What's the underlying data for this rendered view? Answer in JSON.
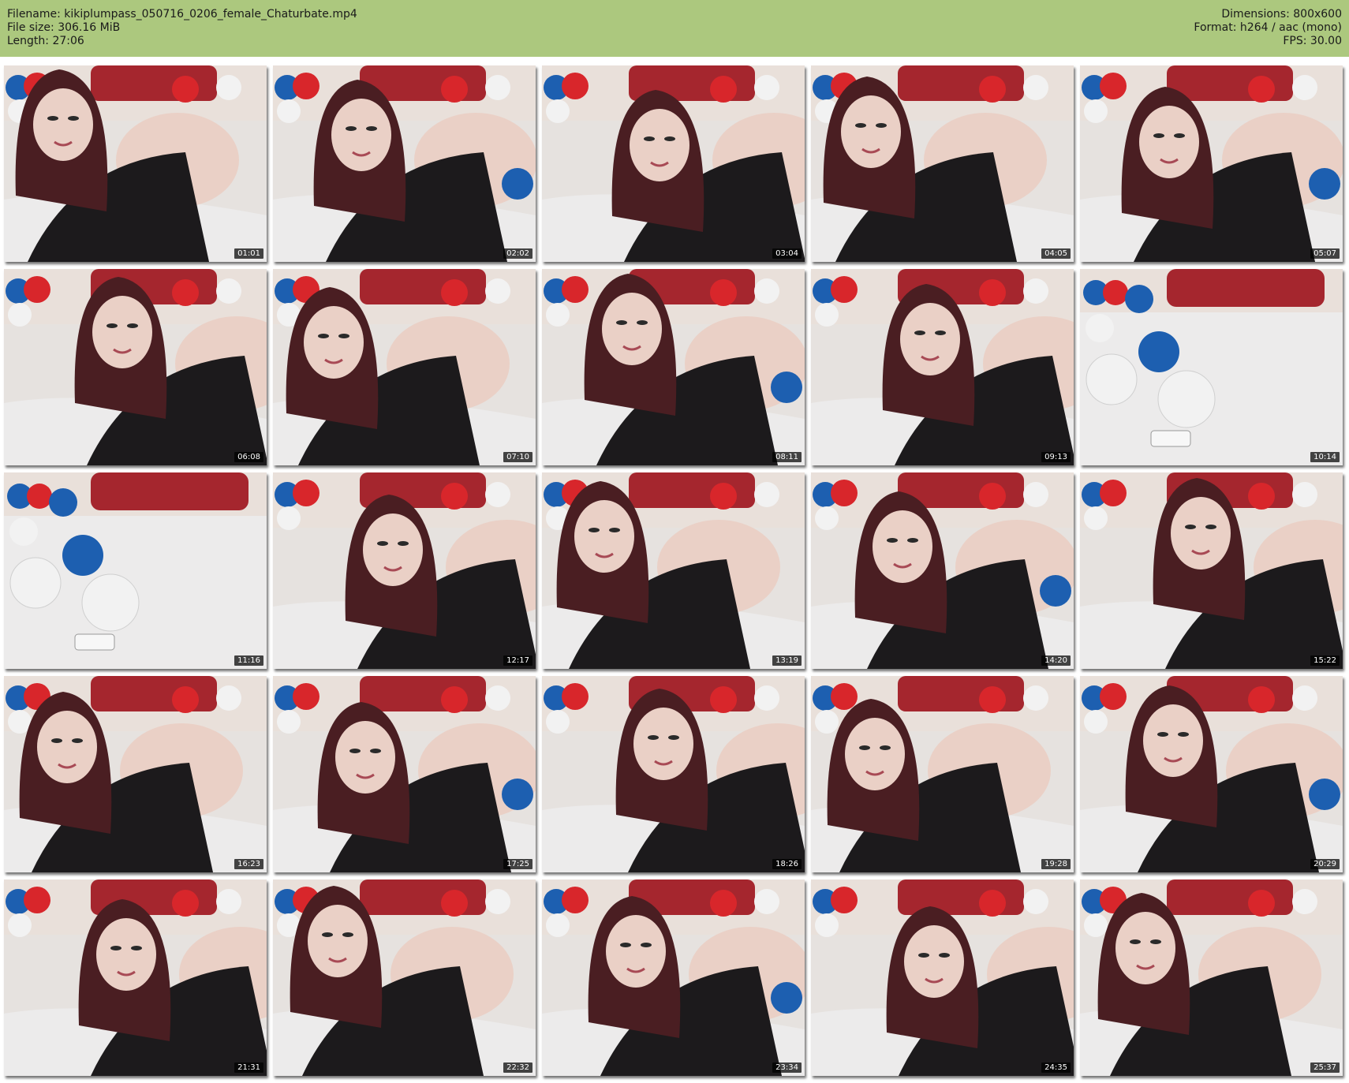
{
  "header": {
    "filename": "Filename: kikiplumpass_050716_0206_female_Chaturbate.mp4",
    "filesize": "File size: 306.16 MiB",
    "length": "Length: 27:06",
    "dimensions": "Dimensions: 800x600",
    "format": "Format: h264 / aac (mono)",
    "fps": "FPS: 30.00"
  },
  "colors": {
    "header_bg": "#acc87e",
    "balloon_red": "#d8262b",
    "balloon_blue": "#1d5fb0",
    "balloon_white": "#f2f2f2",
    "lace": "#1c1a1c",
    "hair": "#4a1e22",
    "skin": "#ead0c6",
    "bedding": "#ecebeb"
  },
  "thumbnails": [
    {
      "time": "01:01",
      "scene": "person"
    },
    {
      "time": "02:02",
      "scene": "person"
    },
    {
      "time": "03:04",
      "scene": "person"
    },
    {
      "time": "04:05",
      "scene": "person"
    },
    {
      "time": "05:07",
      "scene": "person"
    },
    {
      "time": "06:08",
      "scene": "person"
    },
    {
      "time": "07:10",
      "scene": "person"
    },
    {
      "time": "08:11",
      "scene": "person"
    },
    {
      "time": "09:13",
      "scene": "person"
    },
    {
      "time": "10:14",
      "scene": "empty"
    },
    {
      "time": "11:16",
      "scene": "empty"
    },
    {
      "time": "12:17",
      "scene": "person"
    },
    {
      "time": "13:19",
      "scene": "person"
    },
    {
      "time": "14:20",
      "scene": "person"
    },
    {
      "time": "15:22",
      "scene": "person"
    },
    {
      "time": "16:23",
      "scene": "person"
    },
    {
      "time": "17:25",
      "scene": "person"
    },
    {
      "time": "18:26",
      "scene": "person"
    },
    {
      "time": "19:28",
      "scene": "person"
    },
    {
      "time": "20:29",
      "scene": "person"
    },
    {
      "time": "21:31",
      "scene": "person"
    },
    {
      "time": "22:32",
      "scene": "person"
    },
    {
      "time": "23:34",
      "scene": "person"
    },
    {
      "time": "24:35",
      "scene": "person"
    },
    {
      "time": "25:37",
      "scene": "person"
    }
  ]
}
